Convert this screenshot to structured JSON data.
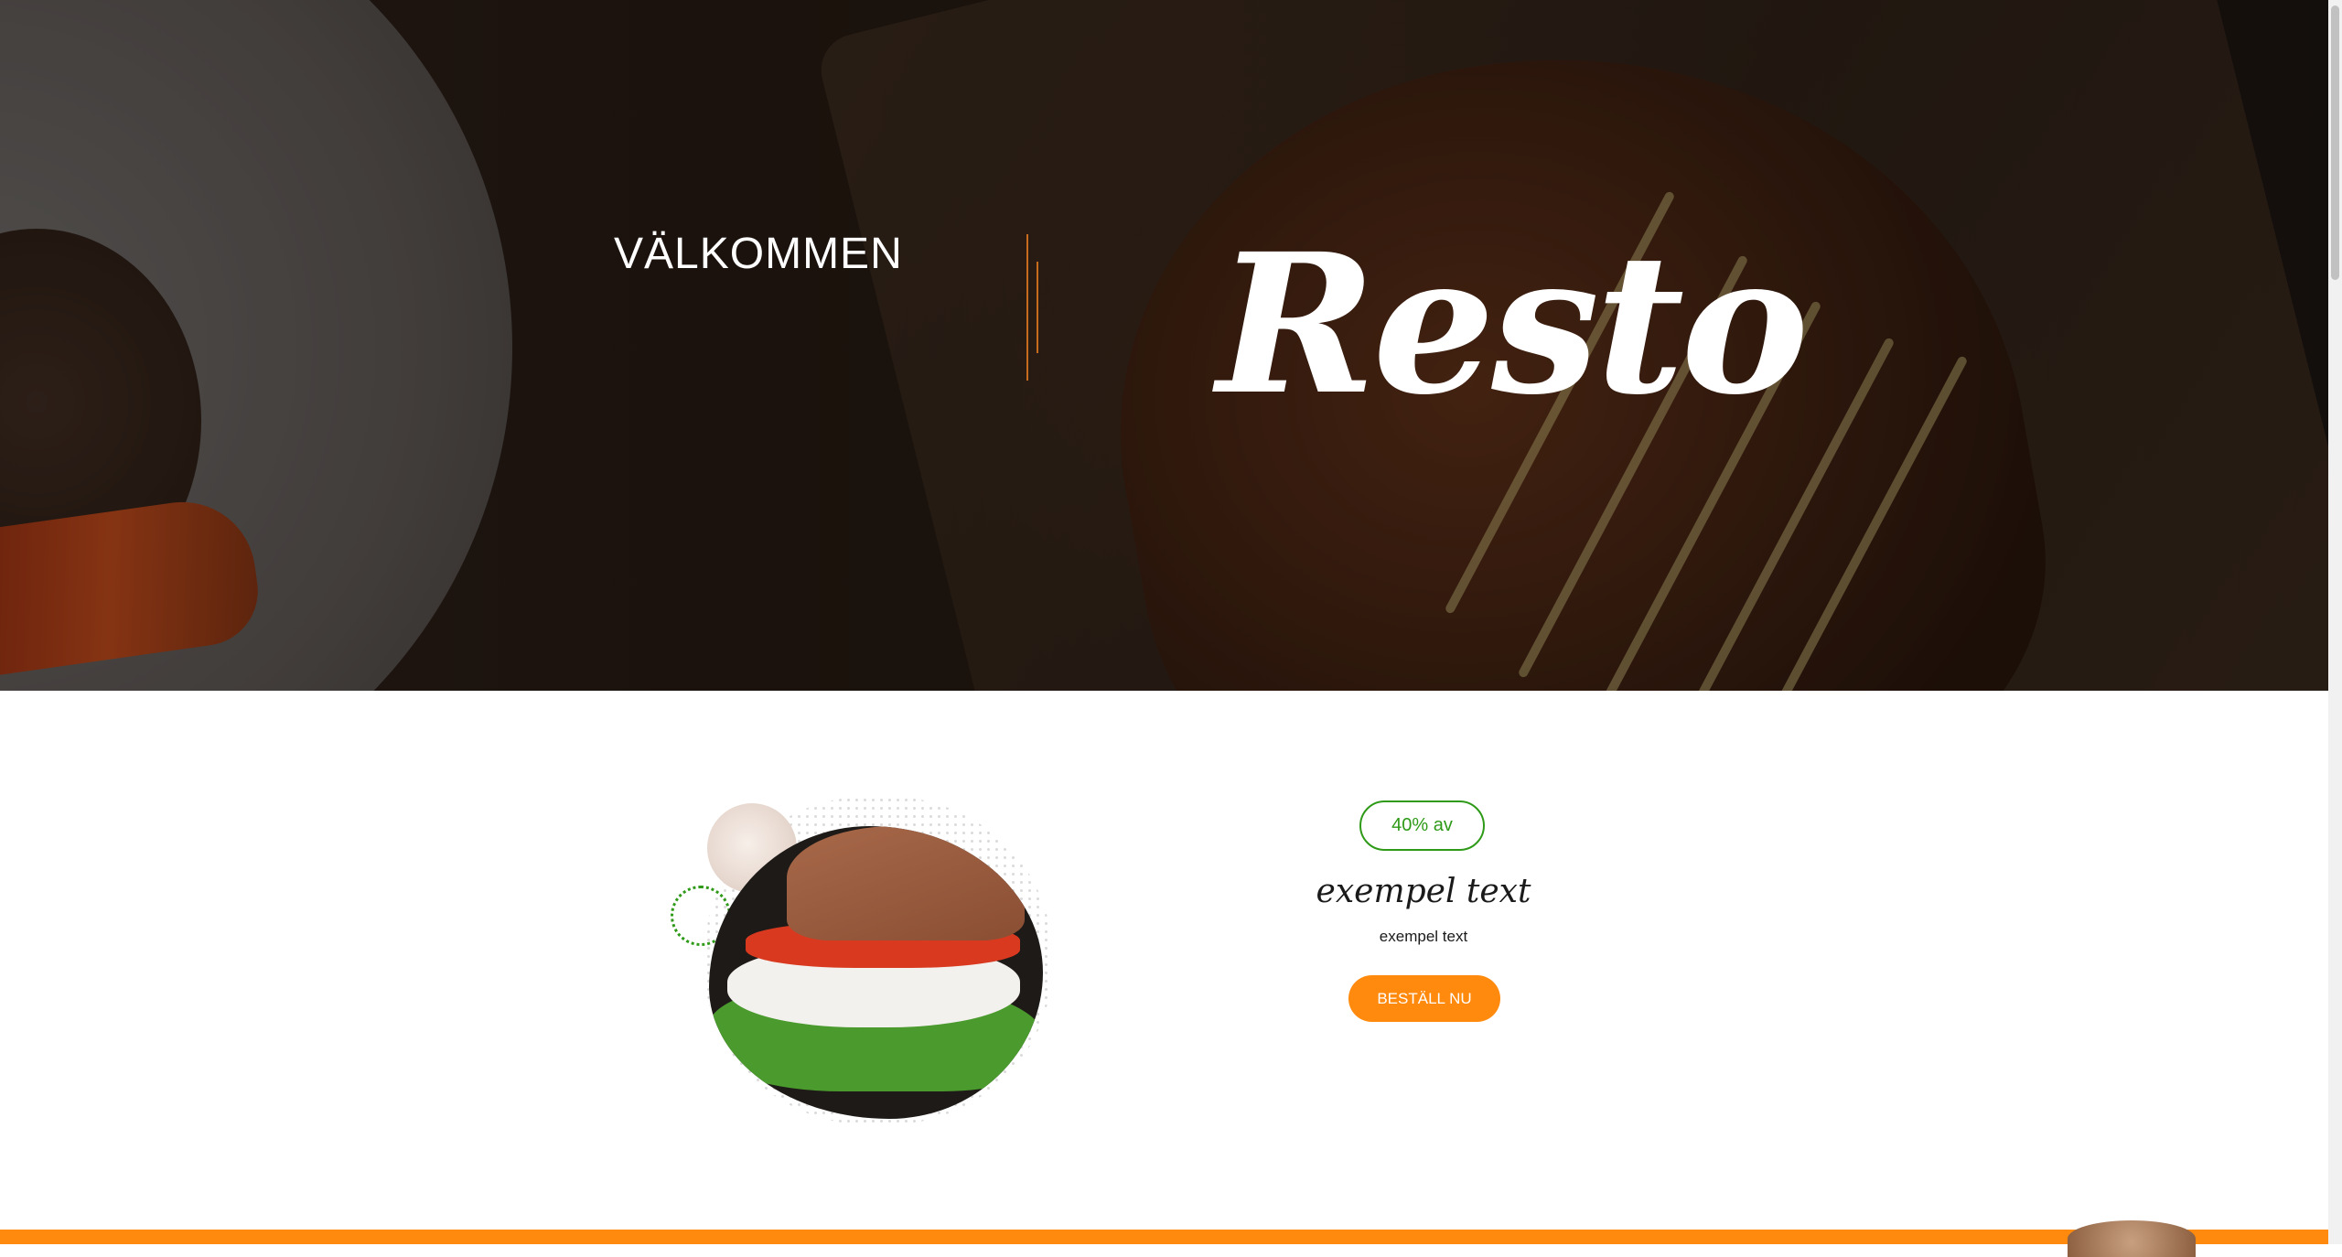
{
  "hero": {
    "welcome": "VÄLKOMMEN",
    "brand": "Resto"
  },
  "offer": {
    "badge": "40% av",
    "title": "exempel text",
    "subtitle": "exempel text",
    "order_button": "BESTÄLL NU"
  },
  "colors": {
    "accent": "#ff8a0d",
    "badge_green": "#2e9a18",
    "divider": "#c76b1c"
  }
}
